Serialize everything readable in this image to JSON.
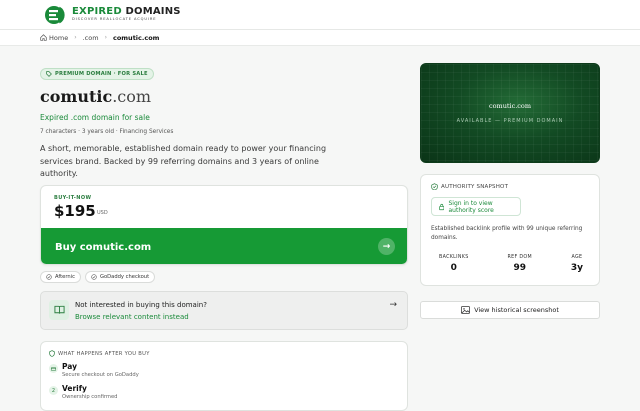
{
  "brand": {
    "title_part1": "EXPIRED",
    "title_part2": " DOMAINS",
    "tagline": "DISCOVER REALLOCATE ACQUIRE"
  },
  "breadcrumb": {
    "home": "Home",
    "tld": ".com",
    "current": "comutic.com"
  },
  "listing": {
    "badge": "PREMIUM DOMAIN · FOR SALE",
    "name": "comutic",
    "tld": ".com",
    "subtitle": "Expired .com domain for sale",
    "meta": "7 characters · 3 years old · Financing Services",
    "description": "A short, memorable, established domain ready to power your financing services brand. Backed by 99 referring domains and 3 years of online authority."
  },
  "purchase": {
    "label": "BUY-IT-NOW",
    "price": "$195",
    "currency": "USD",
    "button": "Buy comutic.com"
  },
  "chips": [
    "Afternic",
    "GoDaddy checkout"
  ],
  "alternative": {
    "question": "Not interested in buying this domain?",
    "link": "Browse relevant content instead"
  },
  "steps": {
    "heading": "WHAT HAPPENS AFTER YOU BUY",
    "items": [
      {
        "num": "",
        "title": "Pay",
        "sub": "Secure checkout on GoDaddy"
      },
      {
        "num": "2",
        "title": "Verify",
        "sub": "Ownership confirmed"
      }
    ]
  },
  "hero": {
    "domain": "comutic.com",
    "caption": "AVAILABLE — PREMIUM DOMAIN"
  },
  "authority": {
    "heading": "AUTHORITY SNAPSHOT",
    "signin": "Sign in to view authority score",
    "desc": "Established backlink profile with 99 unique referring domains.",
    "stats": [
      {
        "label": "BACKLINKS",
        "value": "0"
      },
      {
        "label": "REF DOM",
        "value": "99"
      },
      {
        "label": "AGE",
        "value": "3y"
      }
    ]
  },
  "history_button": "View historical screenshot",
  "colors": {
    "accent": "#169a35",
    "accent_text": "#1a8a3a",
    "hero_dark": "#0a3417"
  }
}
